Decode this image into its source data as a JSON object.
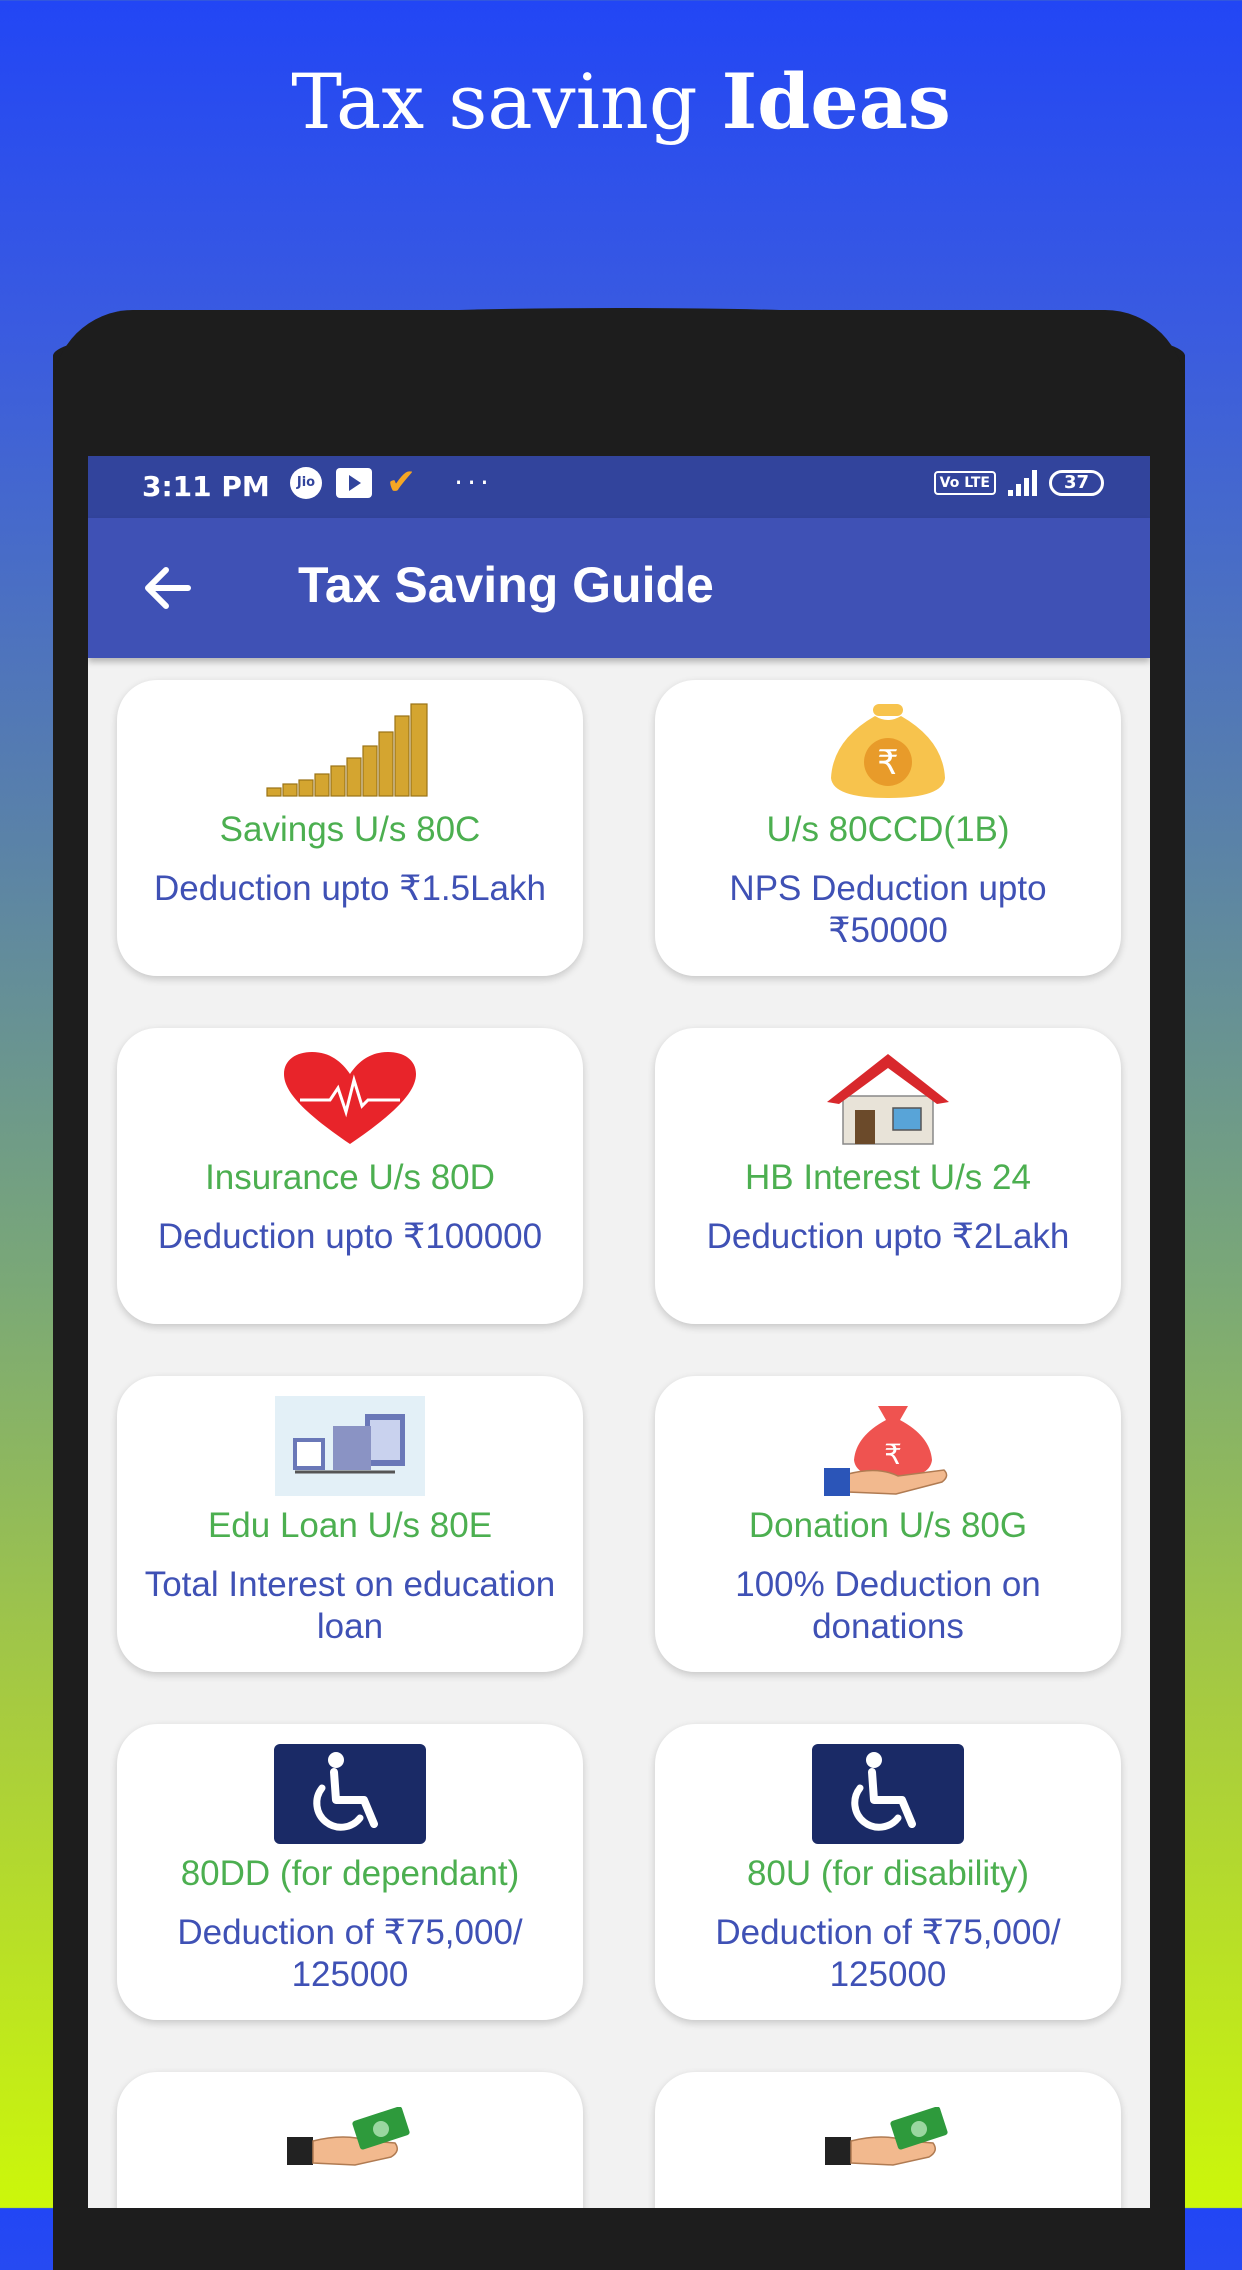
{
  "banner": {
    "title_regular": "Tax saving ",
    "title_bold": "Ideas"
  },
  "status_bar": {
    "time": "3:11 PM",
    "jio": "Jio",
    "volte": "Vo LTE",
    "battery": "37",
    "more": "···"
  },
  "app_bar": {
    "title": "Tax Saving Guide"
  },
  "cards": [
    {
      "icon": "coin-stacks-icon",
      "title": "Savings U/s 80C",
      "desc": "Deduction upto ₹1.5Lakh"
    },
    {
      "icon": "money-bag-rupee-icon",
      "title": "U/s 80CCD(1B)",
      "desc": "NPS Deduction upto ₹50000"
    },
    {
      "icon": "heart-pulse-icon",
      "title": "Insurance U/s 80D",
      "desc": "Deduction upto ₹100000"
    },
    {
      "icon": "house-icon",
      "title": "HB Interest U/s 24",
      "desc": "Deduction upto ₹2Lakh"
    },
    {
      "icon": "books-icon",
      "title": "Edu Loan U/s 80E",
      "desc": "Total Interest on education loan"
    },
    {
      "icon": "donation-bag-icon",
      "title": "Donation U/s 80G",
      "desc": "100% Deduction on donations"
    },
    {
      "icon": "wheelchair-icon",
      "title": "80DD (for dependant)",
      "desc": "Deduction of ₹75,000/ 125000"
    },
    {
      "icon": "wheelchair-icon",
      "title": "80U (for disability)",
      "desc": "Deduction of ₹75,000/ 125000"
    },
    {
      "icon": "hand-money-icon",
      "title": "",
      "desc": ""
    },
    {
      "icon": "hand-money-icon",
      "title": "",
      "desc": ""
    }
  ],
  "colors": {
    "appbar": "#3f51b5",
    "statusbar": "#32449c",
    "card_title": "#4caf50",
    "card_desc": "#3f51b5"
  }
}
